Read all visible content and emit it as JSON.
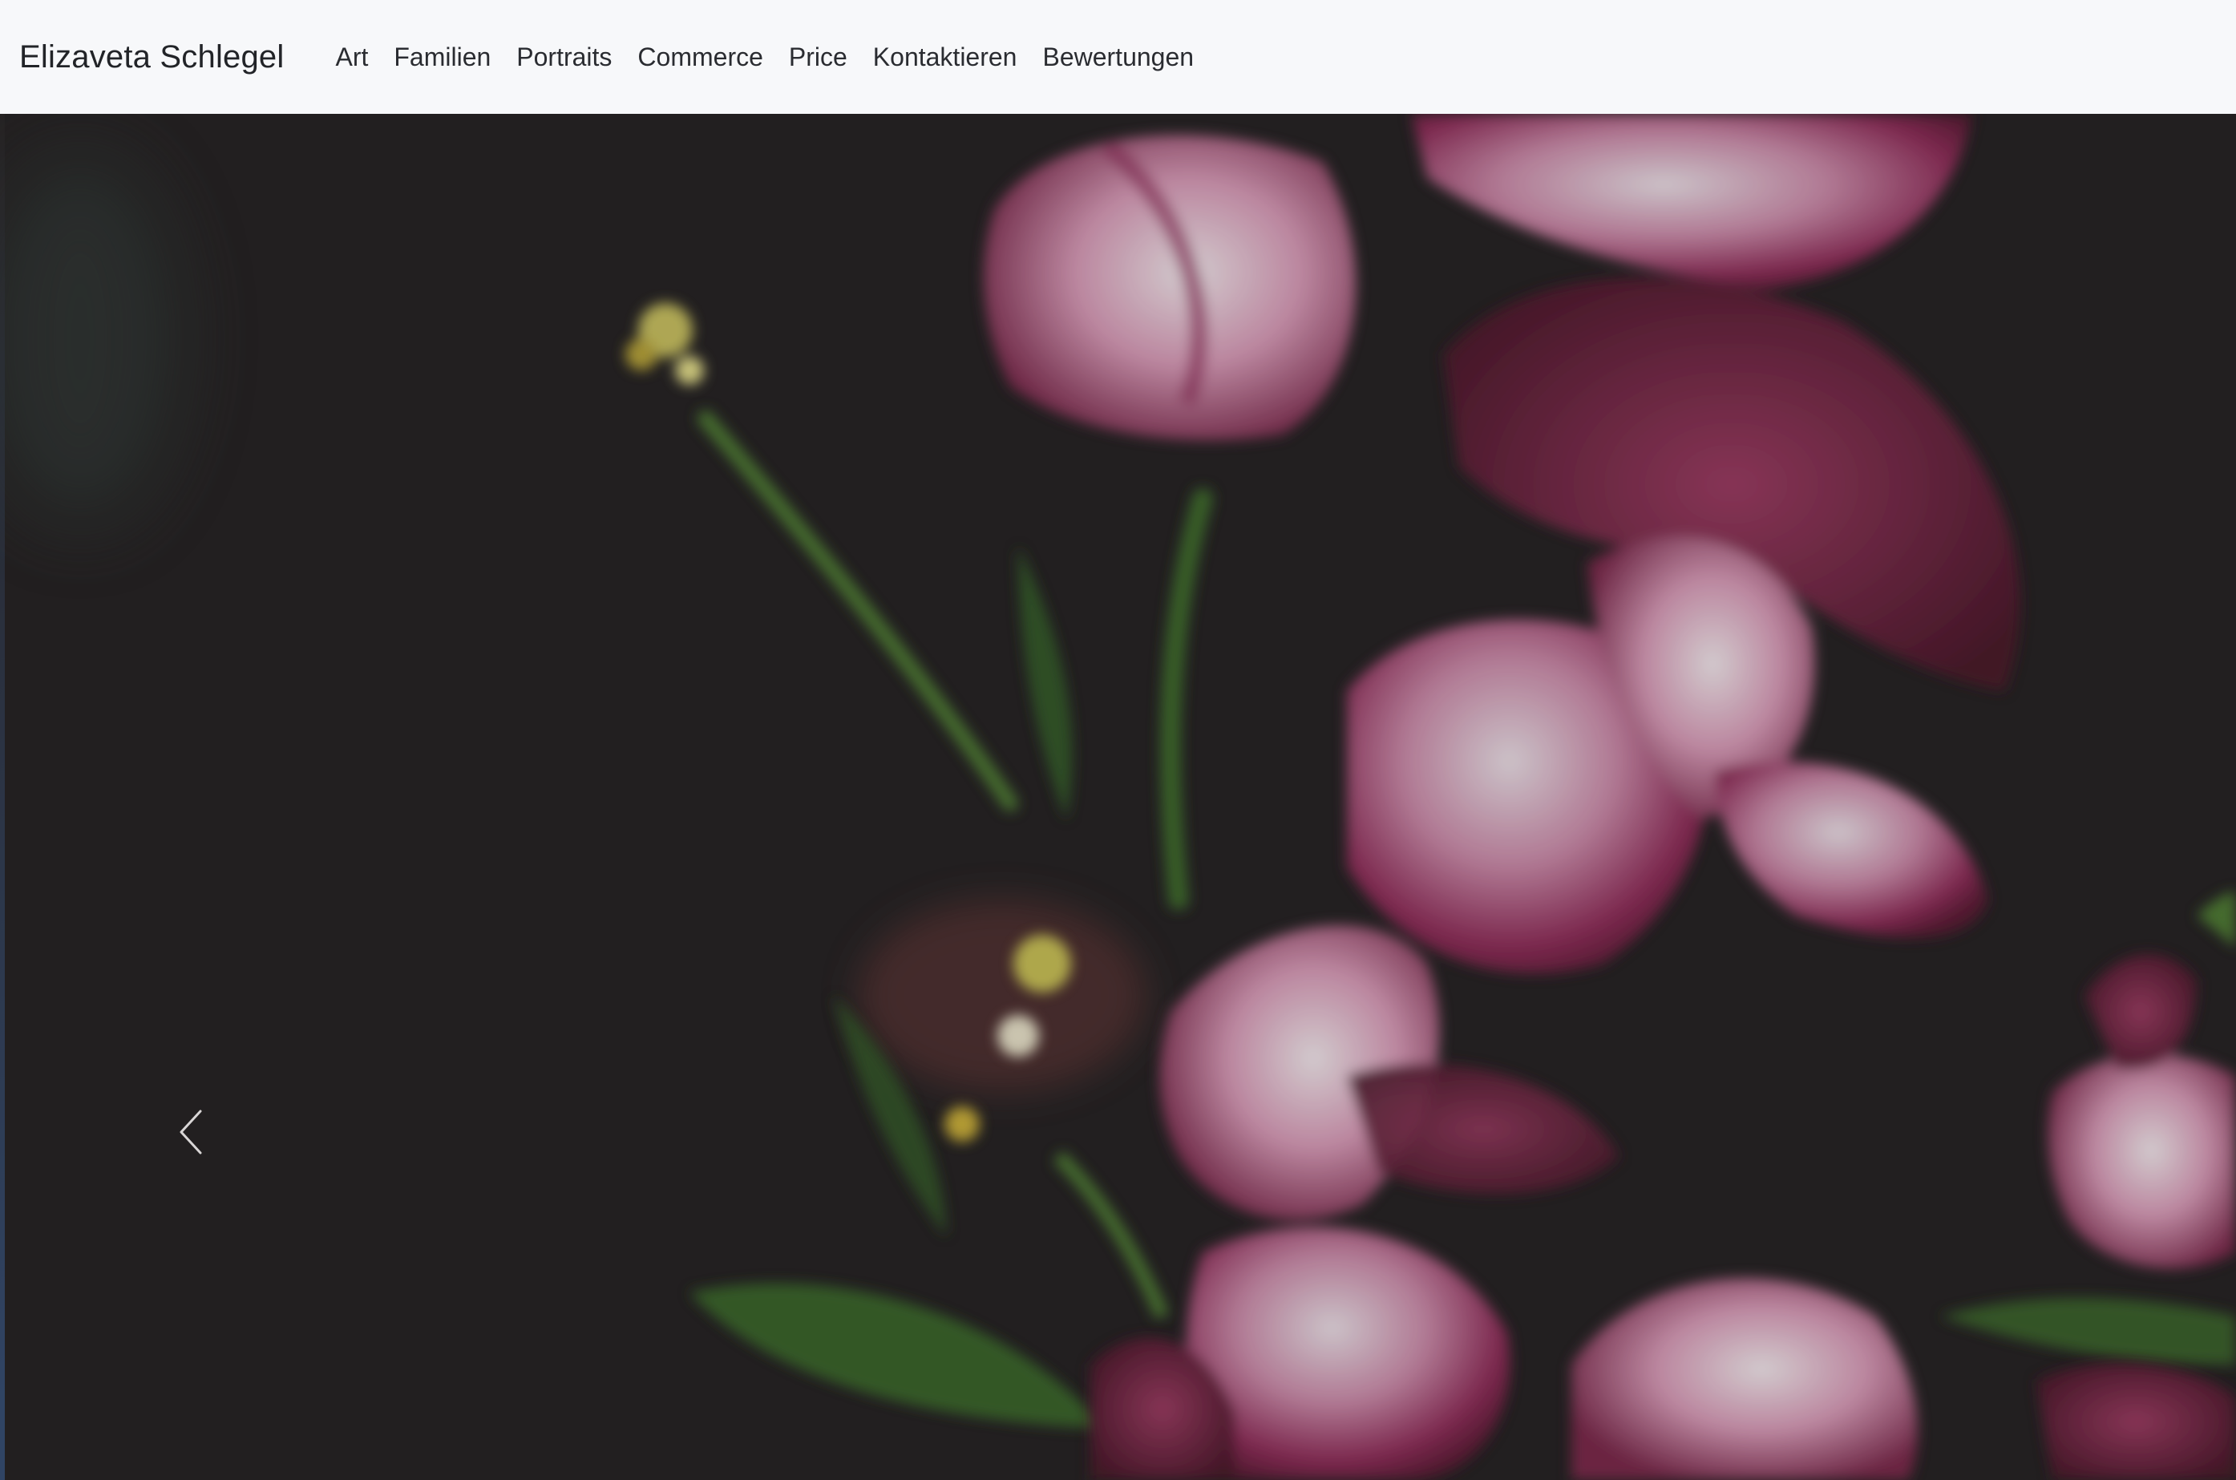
{
  "navbar": {
    "brand": "Elizaveta Schlegel",
    "items": [
      {
        "id": "art",
        "label": "Art"
      },
      {
        "id": "familien",
        "label": "Familien"
      },
      {
        "id": "portraits",
        "label": "Portraits"
      },
      {
        "id": "commerce",
        "label": "Commerce"
      },
      {
        "id": "price",
        "label": "Price"
      },
      {
        "id": "kontaktieren",
        "label": "Kontaktieren"
      },
      {
        "id": "bewertungen",
        "label": "Bewertungen"
      }
    ]
  },
  "hero": {
    "image_subject": "dark still life of wilting pink and white tulips",
    "prev_icon": "chevron-left-icon"
  },
  "colors": {
    "navbar_bg": "#f7f8fa",
    "hero_bg": "#272425",
    "petal_pink": "#b35a82",
    "petal_white": "#e8dde4",
    "leaf_green": "#3f6b2e"
  }
}
